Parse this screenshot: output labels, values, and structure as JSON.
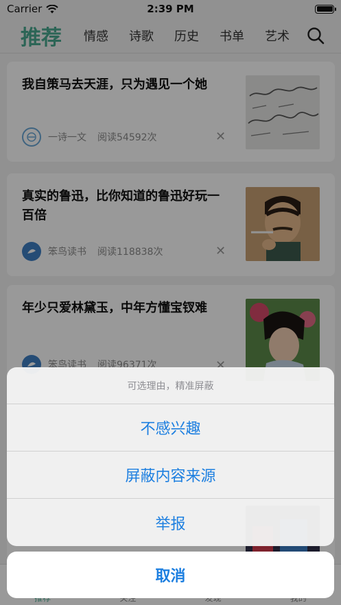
{
  "status": {
    "carrier": "Carrier",
    "time": "2:39 PM"
  },
  "tabs": [
    {
      "label": "推荐",
      "active": true
    },
    {
      "label": "情感"
    },
    {
      "label": "诗歌"
    },
    {
      "label": "历史"
    },
    {
      "label": "书单"
    },
    {
      "label": "艺术"
    }
  ],
  "search_icon": "search-icon",
  "colors": {
    "accent": "#4aa98f",
    "action": "#1d7fe0"
  },
  "articles": [
    {
      "title": "我自策马去天涯，只为遇见一个她",
      "source": "一诗一文",
      "reads": "阅读54592次"
    },
    {
      "title": "真实的鲁迅，比你知道的鲁迅好玩一百倍",
      "source": "笨鸟读书",
      "reads": "阅读118838次"
    },
    {
      "title": "年少只爱林黛玉，中年方懂宝钗难",
      "source": "笨鸟读书",
      "reads": "阅读96371次"
    }
  ],
  "bottom_nav": [
    {
      "label": "推荐"
    },
    {
      "label": "关注"
    },
    {
      "label": "发现"
    },
    {
      "label": "我的"
    }
  ],
  "action_sheet": {
    "title": "可选理由，精准屏蔽",
    "options": [
      "不感兴趣",
      "屏蔽内容来源",
      "举报"
    ],
    "cancel": "取消"
  }
}
